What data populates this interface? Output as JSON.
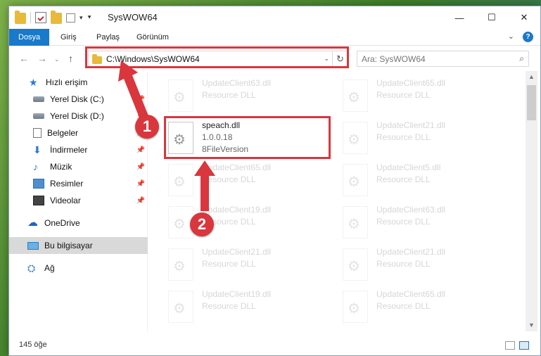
{
  "window": {
    "title": "SysWOW64",
    "minimize": "—",
    "maximize": "☐",
    "close": "✕"
  },
  "ribbon": {
    "tabs": [
      "Dosya",
      "Giriş",
      "Paylaş",
      "Görünüm"
    ]
  },
  "nav": {
    "address": "C:\\Windows\\SysWOW64",
    "search_placeholder": "Ara: SysWOW64"
  },
  "sidebar": {
    "items": [
      {
        "label": "Hızlı erişim",
        "icon": "star-icon"
      },
      {
        "label": "Yerel Disk (C:)",
        "icon": "drive-icon"
      },
      {
        "label": "Yerel Disk (D:)",
        "icon": "drive-icon"
      },
      {
        "label": "Belgeler",
        "icon": "documents-icon"
      },
      {
        "label": "İndirmeler",
        "icon": "download-icon"
      },
      {
        "label": "Müzik",
        "icon": "music-icon"
      },
      {
        "label": "Resimler",
        "icon": "pictures-icon"
      },
      {
        "label": "Videolar",
        "icon": "video-icon"
      },
      {
        "label": "OneDrive",
        "icon": "cloud-icon"
      },
      {
        "label": "Bu bilgisayar",
        "icon": "computer-icon"
      },
      {
        "label": "Ağ",
        "icon": "network-icon"
      }
    ]
  },
  "files": {
    "highlighted": {
      "name": "speach.dll",
      "version": "1.0.0.18",
      "type": "8FileVersion"
    },
    "left": [
      {
        "name": "UpdateClient63.dll",
        "type": "Resource DLL"
      },
      {
        "name": "UpdateClient65.dll",
        "type": "Resource DLL"
      },
      {
        "name": "UpdateClient19.dll",
        "type": "Resource DLL"
      },
      {
        "name": "UpdateClient21.dll",
        "type": "Resource DLL"
      },
      {
        "name": "UpdateClient19.dll",
        "type": "Resource DLL"
      }
    ],
    "right": [
      {
        "name": "UpdateClient65.dll",
        "type": "Resource DLL"
      },
      {
        "name": "UpdateClient21.dll",
        "type": "Resource DLL"
      },
      {
        "name": "UpdateClient5.dll",
        "type": "Resource DLL"
      },
      {
        "name": "UpdateClient63.dll",
        "type": "Resource DLL"
      },
      {
        "name": "UpdateClient21.dll",
        "type": "Resource DLL"
      },
      {
        "name": "UpdateClient65.dll",
        "type": "Resource DLL"
      }
    ]
  },
  "status": {
    "count": "145 öğe"
  },
  "callouts": {
    "one": "1",
    "two": "2"
  },
  "colors": {
    "accent": "#1979ca",
    "highlight": "#d9363e"
  }
}
